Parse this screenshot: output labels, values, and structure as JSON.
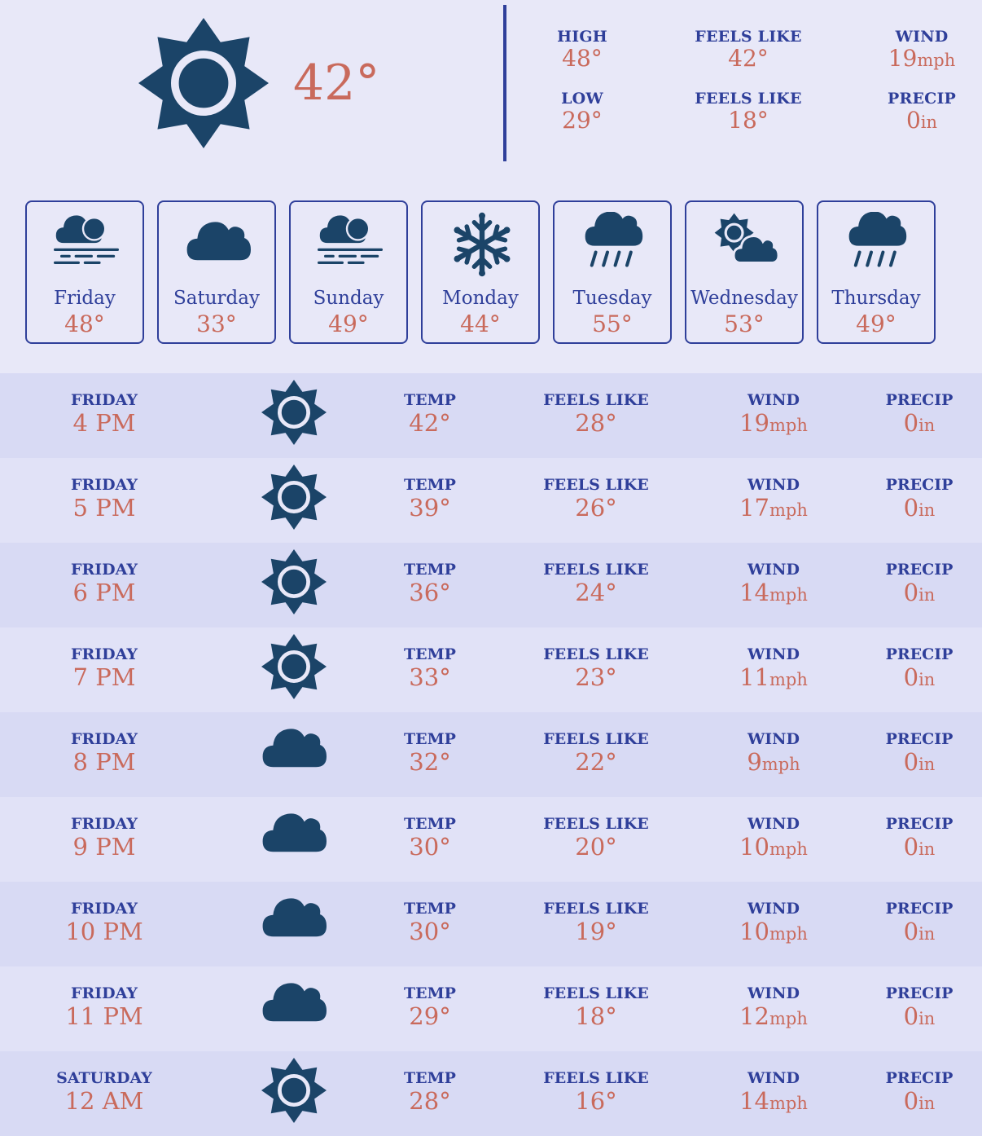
{
  "current": {
    "icon": "sun-icon",
    "temp": "42°",
    "high_label": "HIGH",
    "high": "48°",
    "low_label": "LOW",
    "low": "29°",
    "feels_high_label": "FEELS LIKE",
    "feels_high": "42°",
    "feels_low_label": "FEELS LIKE",
    "feels_low": "18°",
    "wind_label": "WIND",
    "wind": "19",
    "wind_unit": "mph",
    "precip_label": "PRECIP",
    "precip": "0",
    "precip_unit": "in"
  },
  "days": [
    {
      "name": "Friday",
      "temp": "48°",
      "icon": "fog-icon"
    },
    {
      "name": "Saturday",
      "temp": "33°",
      "icon": "cloud-icon"
    },
    {
      "name": "Sunday",
      "temp": "49°",
      "icon": "fog-icon"
    },
    {
      "name": "Monday",
      "temp": "44°",
      "icon": "snowflake-icon"
    },
    {
      "name": "Tuesday",
      "temp": "55°",
      "icon": "rain-icon"
    },
    {
      "name": "Wednesday",
      "temp": "53°",
      "icon": "partly-cloudy-icon"
    },
    {
      "name": "Thursday",
      "temp": "49°",
      "icon": "rain-icon"
    }
  ],
  "hour_labels": {
    "temp": "TEMP",
    "feels": "FEELS LIKE",
    "wind": "WIND",
    "precip": "PRECIP",
    "wind_unit": "mph",
    "precip_unit": "in"
  },
  "hours": [
    {
      "day": "FRIDAY",
      "time": "4 PM",
      "icon": "sun-icon",
      "temp": "42°",
      "feels": "28°",
      "wind": "19",
      "precip": "0"
    },
    {
      "day": "FRIDAY",
      "time": "5 PM",
      "icon": "sun-icon",
      "temp": "39°",
      "feels": "26°",
      "wind": "17",
      "precip": "0"
    },
    {
      "day": "FRIDAY",
      "time": "6 PM",
      "icon": "sun-icon",
      "temp": "36°",
      "feels": "24°",
      "wind": "14",
      "precip": "0"
    },
    {
      "day": "FRIDAY",
      "time": "7 PM",
      "icon": "sun-icon",
      "temp": "33°",
      "feels": "23°",
      "wind": "11",
      "precip": "0"
    },
    {
      "day": "FRIDAY",
      "time": "8 PM",
      "icon": "cloud-icon",
      "temp": "32°",
      "feels": "22°",
      "wind": "9",
      "precip": "0"
    },
    {
      "day": "FRIDAY",
      "time": "9 PM",
      "icon": "cloud-icon",
      "temp": "30°",
      "feels": "20°",
      "wind": "10",
      "precip": "0"
    },
    {
      "day": "FRIDAY",
      "time": "10 PM",
      "icon": "cloud-icon",
      "temp": "30°",
      "feels": "19°",
      "wind": "10",
      "precip": "0"
    },
    {
      "day": "FRIDAY",
      "time": "11 PM",
      "icon": "cloud-icon",
      "temp": "29°",
      "feels": "18°",
      "wind": "12",
      "precip": "0"
    },
    {
      "day": "SATURDAY",
      "time": "12 AM",
      "icon": "sun-icon",
      "temp": "28°",
      "feels": "16°",
      "wind": "14",
      "precip": "0"
    }
  ],
  "colors": {
    "background": "#e8e8f8",
    "accent": "#2f3f9a",
    "value": "#c96a5c",
    "icon": "#1b4468"
  }
}
